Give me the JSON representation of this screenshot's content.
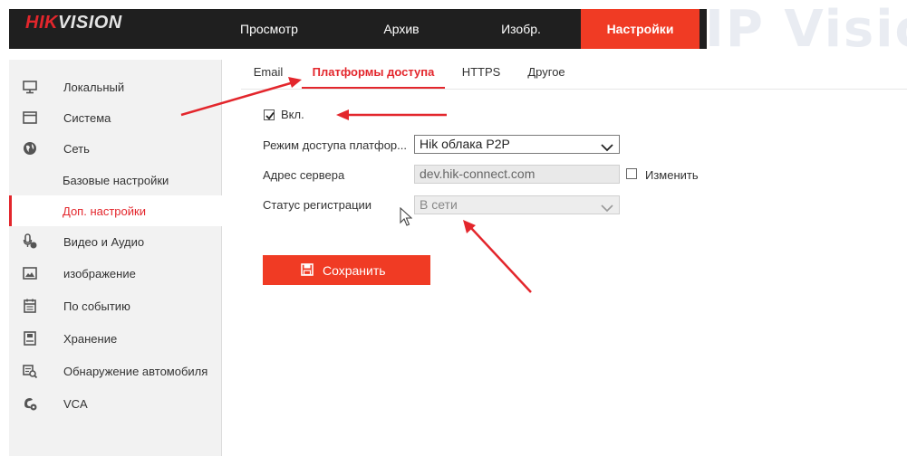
{
  "header": {
    "logo_part1": "HIK",
    "logo_part2": "VISION",
    "nav": [
      {
        "label": "Просмотр"
      },
      {
        "label": "Архив"
      },
      {
        "label": "Изобр."
      },
      {
        "label": "Настройки"
      }
    ],
    "active_nav": "Настройки",
    "watermark": "IP Vision"
  },
  "sidebar": {
    "items": [
      {
        "label": "Локальный",
        "icon": "monitor-icon"
      },
      {
        "label": "Система",
        "icon": "system-window-icon"
      },
      {
        "label": "Сеть",
        "icon": "globe-icon"
      },
      {
        "label": "Базовые настройки",
        "icon": ""
      },
      {
        "label": "Доп. настройки",
        "icon": ""
      },
      {
        "label": "Видео и Аудио",
        "icon": "video-audio-icon"
      },
      {
        "label": "изображение",
        "icon": "image-icon"
      },
      {
        "label": "По событию",
        "icon": "calendar-icon"
      },
      {
        "label": "Хранение",
        "icon": "storage-icon"
      },
      {
        "label": "Обнаружение автомобиля",
        "icon": "vehicle-search-icon"
      },
      {
        "label": "VCA",
        "icon": "vca-icon"
      }
    ],
    "selected": "Доп. настройки"
  },
  "tabs": [
    {
      "label": "Email"
    },
    {
      "label": "Платформы доступа"
    },
    {
      "label": "HTTPS"
    },
    {
      "label": "Другое"
    }
  ],
  "active_tab": "Платформы доступа",
  "form": {
    "enable_label": "Вкл.",
    "enable_checked": true,
    "access_mode_label": "Режим доступа платфор...",
    "access_mode_value": "Hik облака P2P",
    "server_address_label": "Адрес сервера",
    "server_address_value": "dev.hik-connect.com",
    "edit_label": "Изменить",
    "edit_checked": false,
    "reg_status_label": "Статус регистрации",
    "reg_status_value": "В сети",
    "save_label": "Сохранить"
  },
  "colors": {
    "accent": "#f03b24",
    "header_bg": "#1f1f1f",
    "sidebar_bg": "#f2f2f2",
    "annotation": "#e3262c"
  }
}
